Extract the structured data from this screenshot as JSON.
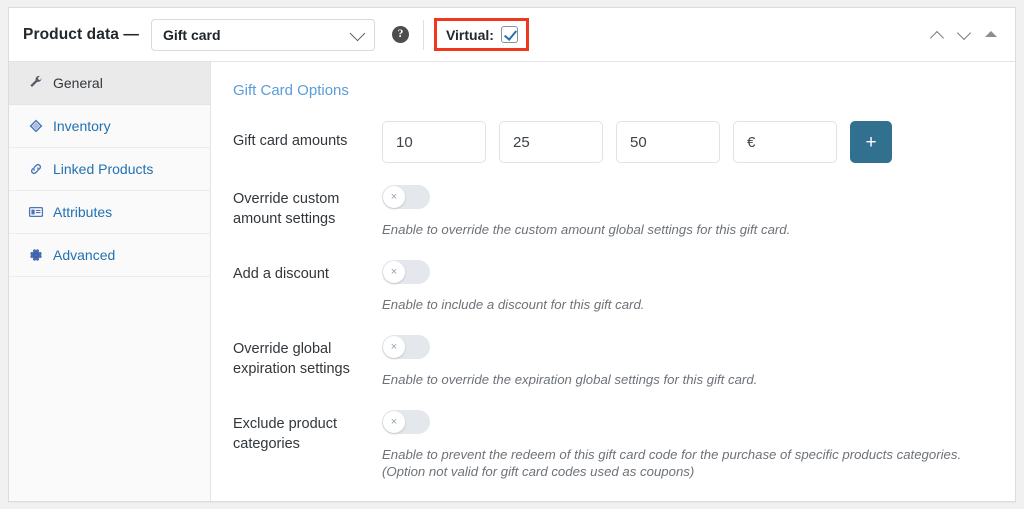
{
  "header": {
    "title": "Product data —",
    "product_type": "Gift card",
    "help_icon": "help-circle-icon",
    "virtual_label": "Virtual:",
    "virtual_checked": true,
    "highlight_color": "#f0361d",
    "move_up_icon": "chevron-up-icon",
    "move_down_icon": "chevron-down-icon",
    "collapse_icon": "triangle-up-icon"
  },
  "sidebar": {
    "items": [
      {
        "label": "General",
        "icon": "wrench-icon",
        "active": true
      },
      {
        "label": "Inventory",
        "icon": "tag-icon",
        "active": false
      },
      {
        "label": "Linked Products",
        "icon": "link-icon",
        "active": false
      },
      {
        "label": "Attributes",
        "icon": "list-view-icon",
        "active": false
      },
      {
        "label": "Advanced",
        "icon": "gear-icon",
        "active": false
      }
    ]
  },
  "main": {
    "section_title": "Gift Card Options",
    "amounts": {
      "label": "Gift card amounts",
      "values": [
        "10",
        "25",
        "50",
        "€"
      ],
      "add_button_label": "+",
      "add_button_color": "#31708f"
    },
    "toggles": [
      {
        "label": "Override custom amount settings",
        "state": "off",
        "knob_glyph": "×",
        "hint": "Enable to override the custom amount global settings for this gift card.",
        "hint2": ""
      },
      {
        "label": "Add a discount",
        "state": "off",
        "knob_glyph": "×",
        "hint": "Enable to include a discount for this gift card.",
        "hint2": ""
      },
      {
        "label": "Override global expiration settings",
        "state": "off",
        "knob_glyph": "×",
        "hint": "Enable to override the expiration global settings for this gift card.",
        "hint2": ""
      },
      {
        "label": "Exclude product categories",
        "state": "off",
        "knob_glyph": "×",
        "hint": "Enable to prevent the redeem of this gift card code for the purchase of specific products categories.",
        "hint2": "(Option not valid for gift card codes used as coupons)"
      }
    ]
  }
}
